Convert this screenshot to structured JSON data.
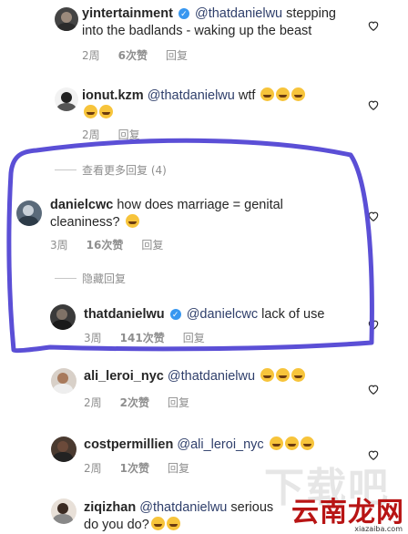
{
  "comments": [
    {
      "username": "yintertainment",
      "verified": true,
      "mention": "@thatdanielwu",
      "text_line1": " stepping",
      "text_line2": "into the badlands - waking up the beast",
      "time": "2周",
      "likes": "6次赞",
      "reply": "回复"
    },
    {
      "username": "ionut.kzm",
      "mention": "@thatdanielwu",
      "text": " wtf",
      "time": "2周",
      "reply": "回复"
    },
    {
      "username": "danielcwc",
      "text_line1": " how does marriage = genital",
      "text_line2": "cleaniness?",
      "time": "3周",
      "likes": "16次赞",
      "reply": "回复"
    },
    {
      "username": "thatdanielwu",
      "verified": true,
      "mention": "@danielcwc",
      "text": " lack of use",
      "time": "3周",
      "likes": "141次赞",
      "reply": "回复"
    },
    {
      "username": "ali_leroi_nyc",
      "mention": "@thatdanielwu",
      "time": "2周",
      "likes": "2次赞",
      "reply": "回复"
    },
    {
      "username": "costpermillien",
      "mention": "@ali_leroi_nyc",
      "time": "2周",
      "likes": "1次赞",
      "reply": "回复"
    },
    {
      "username": "ziqizhan",
      "mention": "@thatdanielwu",
      "text_line1": " serious",
      "text_line2": "do you do?",
      "time": "",
      "reply": ""
    }
  ],
  "view_more_replies": "查看更多回复 (4)",
  "hide_replies": "隐藏回复",
  "highlight_color": "#5b4fd6",
  "watermark": {
    "main": "云南龙网",
    "sub": "xiazaiba.com",
    "bg": "下载吧"
  }
}
